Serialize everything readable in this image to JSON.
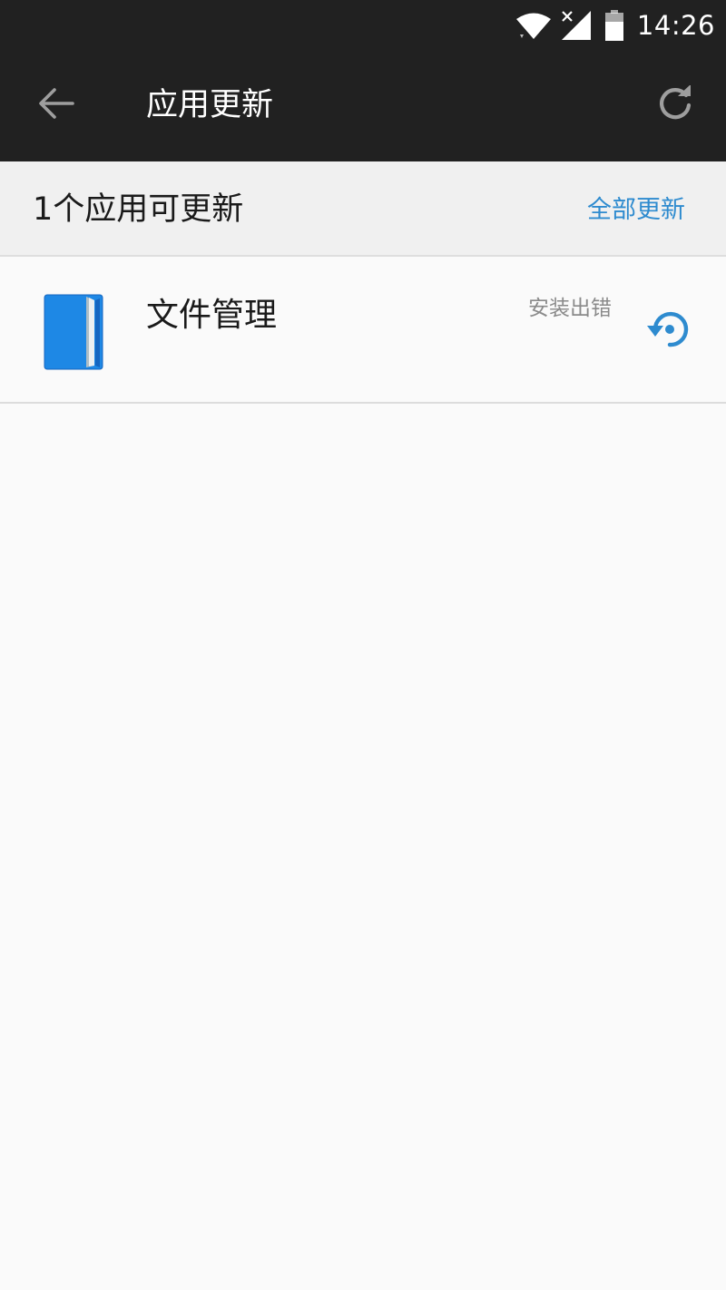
{
  "status_bar": {
    "time": "14:26",
    "icons": [
      "wifi-icon",
      "signal-no-service-icon",
      "battery-icon"
    ]
  },
  "toolbar": {
    "title": "应用更新",
    "back_icon": "arrow-back-icon",
    "refresh_icon": "refresh-icon"
  },
  "summary": {
    "count_text": "1个应用可更新",
    "update_all_label": "全部更新"
  },
  "apps": [
    {
      "name": "文件管理",
      "status": "安装出错",
      "icon": "file-manager-folder-icon",
      "action_icon": "retry-icon"
    }
  ],
  "colors": {
    "bar_background": "#212121",
    "summary_background": "#f0f0f0",
    "accent": "#2e8bcf",
    "page_background": "#fafafa",
    "icon_blue": "#1e88e5"
  }
}
